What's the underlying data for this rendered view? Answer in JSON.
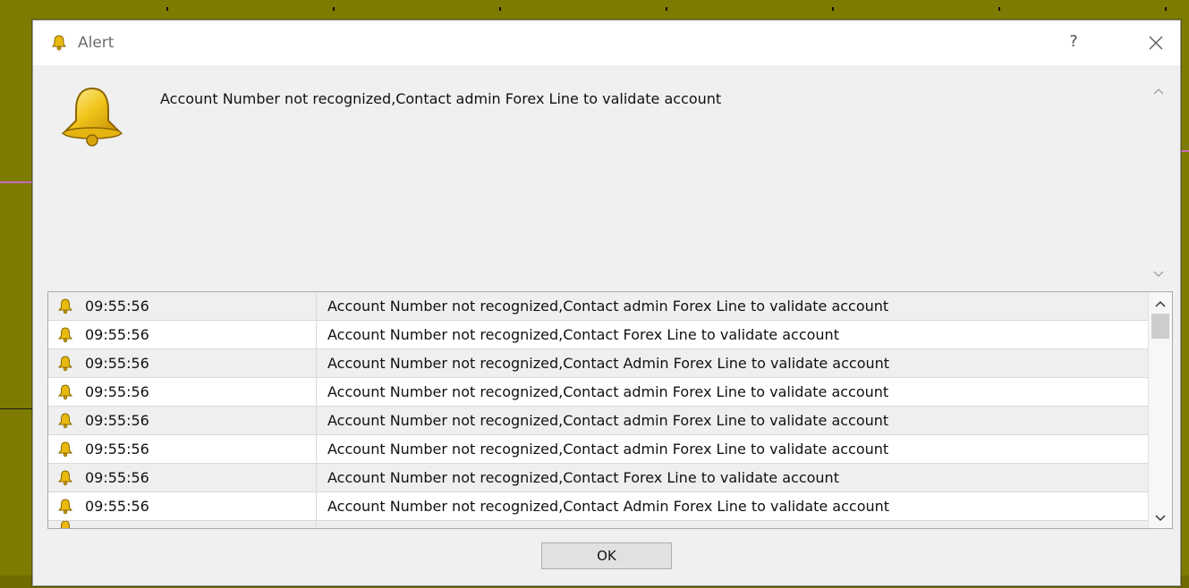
{
  "window": {
    "title": "Alert",
    "help_label": "?",
    "icon": "bell-icon",
    "close_icon": "close-icon"
  },
  "message": "Account Number not recognized,Contact admin Forex Line to validate account",
  "alerts": [
    {
      "time": "09:55:56",
      "message": "Account Number not recognized,Contact admin Forex Line to validate account"
    },
    {
      "time": "09:55:56",
      "message": "Account Number not recognized,Contact Forex Line to validate account"
    },
    {
      "time": "09:55:56",
      "message": "Account Number not recognized,Contact Admin Forex Line to validate account"
    },
    {
      "time": "09:55:56",
      "message": "Account Number not recognized,Contact admin Forex Line to validate account"
    },
    {
      "time": "09:55:56",
      "message": "Account Number not recognized,Contact admin Forex Line to validate account"
    },
    {
      "time": "09:55:56",
      "message": "Account Number not recognized,Contact admin Forex Line to validate account"
    },
    {
      "time": "09:55:56",
      "message": "Account Number not recognized,Contact Forex Line to validate account"
    },
    {
      "time": "09:55:56",
      "message": "Account Number not recognized,Contact Admin Forex Line to validate account"
    }
  ],
  "ok_label": "OK",
  "colors": {
    "chart_background": "#7d7b02",
    "dialog_background": "#f0f0f0",
    "bell_gold": "#e8b90f"
  }
}
